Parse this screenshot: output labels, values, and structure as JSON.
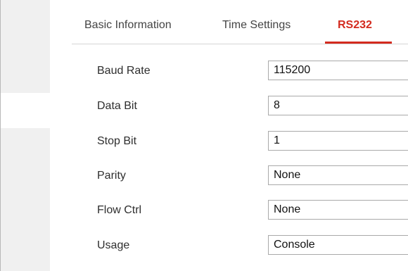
{
  "tabs": [
    {
      "label": "Basic Information",
      "active": false
    },
    {
      "label": "Time Settings",
      "active": false
    },
    {
      "label": "RS232",
      "active": true
    }
  ],
  "accent_color": "#d32b1f",
  "form": {
    "fields": [
      {
        "label": "Baud Rate",
        "value": "115200"
      },
      {
        "label": "Data Bit",
        "value": "8"
      },
      {
        "label": "Stop Bit",
        "value": "1"
      },
      {
        "label": "Parity",
        "value": "None"
      },
      {
        "label": "Flow Ctrl",
        "value": "None"
      },
      {
        "label": "Usage",
        "value": "Console"
      }
    ]
  }
}
